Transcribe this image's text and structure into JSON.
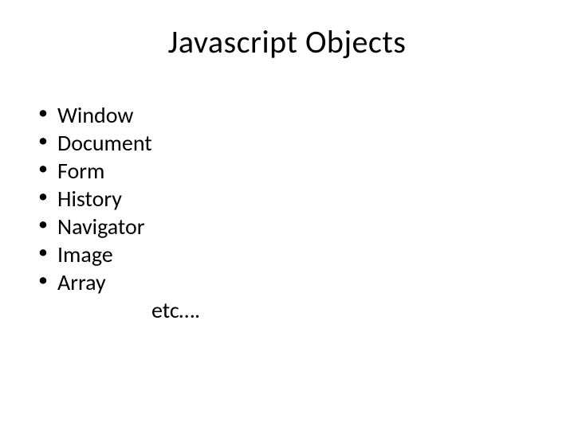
{
  "title": "Javascript Objects",
  "bullets": [
    "Window",
    "Document",
    "Form",
    "History",
    "Navigator",
    "Image",
    "Array"
  ],
  "trailing": "etc…."
}
